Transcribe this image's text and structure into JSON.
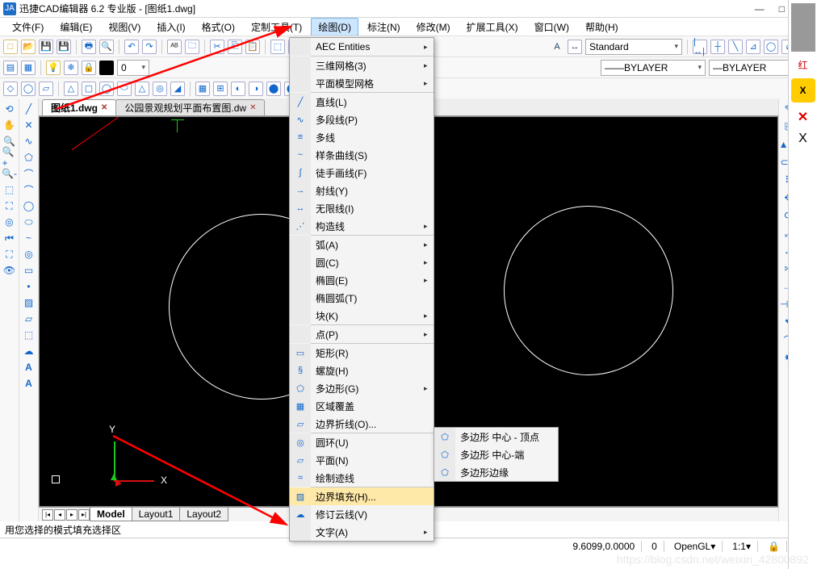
{
  "title": "迅捷CAD编辑器 6.2 专业版  - [图纸1.dwg]",
  "menubar": [
    "文件(F)",
    "编辑(E)",
    "视图(V)",
    "插入(I)",
    "格式(O)",
    "定制工具(T)",
    "绘图(D)",
    "标注(N)",
    "修改(M)",
    "扩展工具(X)",
    "窗口(W)",
    "帮助(H)"
  ],
  "active_menu": 6,
  "toolbar2": {
    "style_sel": "Standard",
    "layer_sel1": "BYLAYER",
    "layer_sel2": "BYLAYER"
  },
  "doc_tabs": [
    {
      "label": "图纸1.dwg",
      "active": true
    },
    {
      "label": "公园景观规划平面布置图.dw",
      "active": false
    }
  ],
  "layout_tabs": [
    "Model",
    "Layout1",
    "Layout2"
  ],
  "dropdown": [
    {
      "label": "AEC Entities",
      "sub": true
    },
    {
      "sep": true
    },
    {
      "label": "三维网格(3)",
      "sub": true
    },
    {
      "label": "平面模型网格",
      "sub": true
    },
    {
      "sep": true
    },
    {
      "label": "直线(L)",
      "icon": "╱"
    },
    {
      "label": "多段线(P)",
      "icon": "∿"
    },
    {
      "label": "多线",
      "icon": "≡"
    },
    {
      "label": "样条曲线(S)",
      "icon": "~"
    },
    {
      "label": "徒手画线(F)",
      "icon": "ʃ"
    },
    {
      "label": "射线(Y)",
      "icon": "→"
    },
    {
      "label": "无限线(I)",
      "icon": "↔"
    },
    {
      "label": "构造线",
      "sub": true,
      "icon": "⋰"
    },
    {
      "sep": true
    },
    {
      "label": "弧(A)",
      "sub": true
    },
    {
      "label": "圆(C)",
      "sub": true
    },
    {
      "label": "椭圆(E)",
      "sub": true
    },
    {
      "label": "椭圆弧(T)"
    },
    {
      "label": "块(K)",
      "sub": true
    },
    {
      "sep": true
    },
    {
      "label": "点(P)",
      "sub": true
    },
    {
      "sep": true
    },
    {
      "label": "矩形(R)",
      "icon": "▭"
    },
    {
      "label": "螺旋(H)",
      "icon": "§"
    },
    {
      "label": "多边形(G)",
      "sub": true,
      "icon": "⬠",
      "hl": false
    },
    {
      "label": "区域覆盖",
      "icon": "▦"
    },
    {
      "label": "边界折线(O)...",
      "icon": "▱"
    },
    {
      "sep": true
    },
    {
      "label": "圆环(U)",
      "icon": "◎"
    },
    {
      "label": "平面(N)",
      "icon": "▱"
    },
    {
      "label": "绘制迹线",
      "icon": "≈"
    },
    {
      "sep": true
    },
    {
      "label": "边界填充(H)...",
      "icon": "▨",
      "hl": true
    },
    {
      "label": "修订云线(V)",
      "icon": "☁"
    },
    {
      "label": "文字(A)",
      "sub": true
    }
  ],
  "submenu": [
    {
      "label": "多边形 中心 - 顶点",
      "icon": "⬠"
    },
    {
      "label": "多边形 中心-端",
      "icon": "⬠"
    },
    {
      "label": "多边形边缘",
      "icon": "⬠"
    }
  ],
  "status_hint": "用您选择的模式填充选择区",
  "status_coord": "9.6099,0.0000",
  "status_zero": "0",
  "status_gl": "OpenGL",
  "status_scale": "1:1",
  "ucs": {
    "x": "X",
    "y": "Y"
  },
  "right_ext_label": "红"
}
